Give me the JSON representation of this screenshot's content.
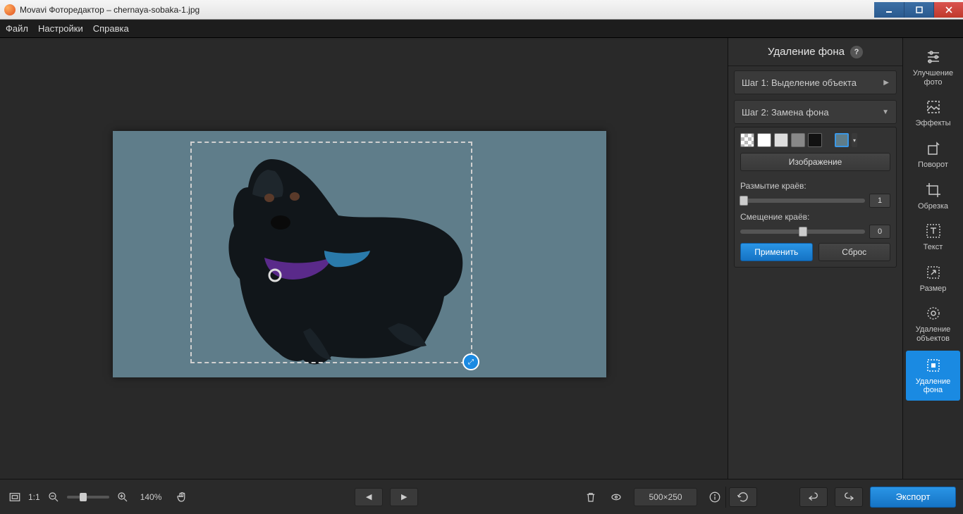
{
  "titlebar": {
    "title": "Movavi Фоторедактор – chernaya-sobaka-1.jpg"
  },
  "menu": {
    "file": "Файл",
    "settings": "Настройки",
    "help": "Справка"
  },
  "panel": {
    "title": "Удаление фона",
    "step1": "Шаг 1: Выделение объекта",
    "step2": "Шаг 2: Замена фона",
    "image_btn": "Изображение",
    "blur_label": "Размытие краёв:",
    "blur_value": "1",
    "offset_label": "Смещение краёв:",
    "offset_value": "0",
    "apply": "Применить",
    "reset": "Сброс"
  },
  "tools": {
    "enhance": "Улучшение\nфото",
    "effects": "Эффекты",
    "rotate": "Поворот",
    "crop": "Обрезка",
    "text": "Текст",
    "resize": "Размер",
    "object_removal": "Удаление\nобъектов",
    "bg_removal": "Удаление\nфона"
  },
  "bottom": {
    "zoom_ratio": "1:1",
    "zoom_pct": "140%",
    "dimensions": "500×250",
    "export": "Экспорт"
  }
}
